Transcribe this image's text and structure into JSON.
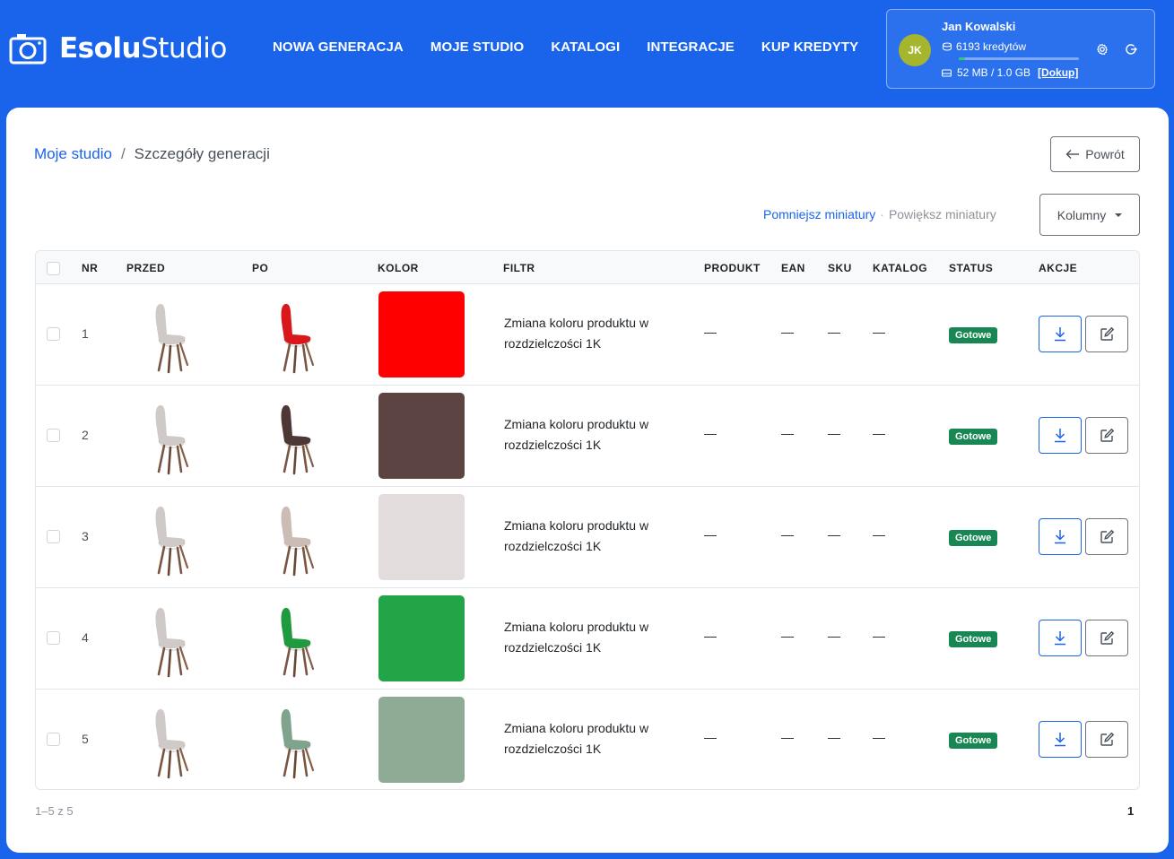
{
  "brand": {
    "bold": "Esolu",
    "light": "Studio"
  },
  "nav": [
    {
      "label": "NOWA GENERACJA"
    },
    {
      "label": "MOJE STUDIO"
    },
    {
      "label": "KATALOGI"
    },
    {
      "label": "INTEGRACJE"
    },
    {
      "label": "KUP KREDYTY"
    }
  ],
  "user": {
    "initials": "JK",
    "name": "Jan Kowalski",
    "credits": "6193 kredytów",
    "storage": "52 MB / 1.0 GB",
    "topup": "[Dokup]",
    "storage_fraction": 0.05
  },
  "breadcrumb": {
    "root": "Moje studio",
    "sep": "/",
    "current": "Szczegóły generacji"
  },
  "back_label": "Powrót",
  "zoom": {
    "smaller": "Pomniejsz miniatury",
    "dot": "·",
    "bigger": "Powiększ miniatury"
  },
  "columns_label": "Kolumny",
  "table": {
    "headers": {
      "nr": "NR",
      "before": "PRZED",
      "after": "PO",
      "color": "KOLOR",
      "filter": "FILTR",
      "product": "PRODUKT",
      "ean": "EAN",
      "sku": "SKU",
      "catalog": "KATALOG",
      "status": "STATUS",
      "actions": "AKCJE"
    },
    "rows": [
      {
        "nr": "1",
        "color": "#ff0000",
        "filter": "Zmiana koloru produktu w rozdzielczości 1K",
        "product": "—",
        "ean": "—",
        "sku": "—",
        "catalog": "—",
        "status": "Gotowe"
      },
      {
        "nr": "2",
        "color": "#5c4442",
        "filter": "Zmiana koloru produktu w rozdzielczości 1K",
        "product": "—",
        "ean": "—",
        "sku": "—",
        "catalog": "—",
        "status": "Gotowe"
      },
      {
        "nr": "3",
        "color": "#e3dcdc",
        "filter": "Zmiana koloru produktu w rozdzielczości 1K",
        "product": "—",
        "ean": "—",
        "sku": "—",
        "catalog": "—",
        "status": "Gotowe"
      },
      {
        "nr": "4",
        "color": "#22a447",
        "filter": "Zmiana koloru produktu w rozdzielczości 1K",
        "product": "—",
        "ean": "—",
        "sku": "—",
        "catalog": "—",
        "status": "Gotowe"
      },
      {
        "nr": "5",
        "color": "#8fab96",
        "filter": "Zmiana koloru produktu w rozdzielczości 1K",
        "product": "—",
        "ean": "—",
        "sku": "—",
        "catalog": "—",
        "status": "Gotowe"
      }
    ]
  },
  "chair_before_color": "#cfcac7",
  "chair_after_colors": [
    "#d8191c",
    "#4e3835",
    "#cbbcb6",
    "#1f9a3e",
    "#7fa38c"
  ],
  "pagination": {
    "range": "1–5 z 5",
    "page": "1"
  }
}
